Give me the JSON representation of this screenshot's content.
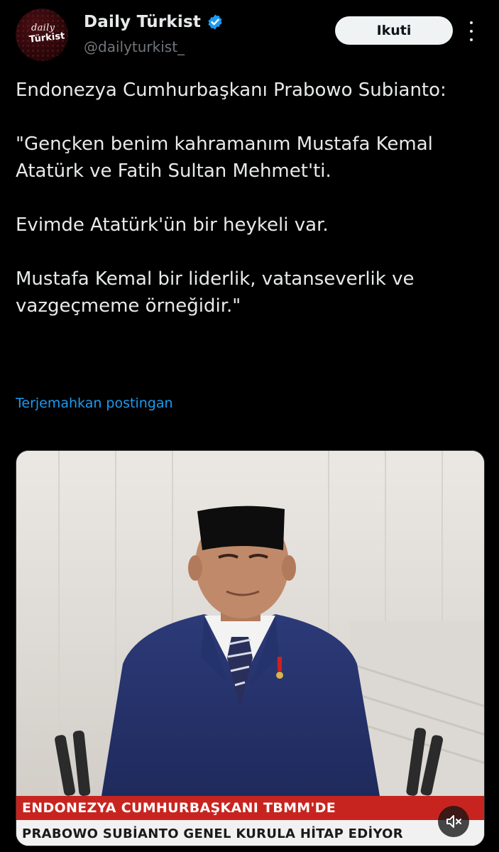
{
  "account": {
    "display_name": "Daily Türkist",
    "handle": "@dailyturkist_",
    "verified_icon": "verified-badge-icon",
    "avatar_text_line1": "daily",
    "avatar_text_line2": "Türkist"
  },
  "actions": {
    "follow_label": "Ikuti",
    "more_icon": "more-options-icon"
  },
  "tweet": {
    "lines": [
      "Endonezya Cumhurbaşkanı Prabowo Subianto:",
      "\"Gençken benim kahramanım Mustafa Kemal Atatürk ve Fatih Sultan Mehmet'ti.",
      "Evimde Atatürk'ün bir heykeli var.",
      "Mustafa Kemal bir liderlik, vatanseverlik ve vazgeçmeme örneğidir.\""
    ],
    "translate_label": "Terjemahkan postingan"
  },
  "media": {
    "ticker_top": "ENDONEZYA CUMHURBAŞKANI TBMM'DE",
    "ticker_bottom": "PRABOWO SUBİANTO GENEL KURULA HİTAP EDİYOR",
    "mute_icon": "muted-speaker-icon"
  },
  "colors": {
    "background": "#000000",
    "text": "#e7e9ea",
    "secondary_text": "#71767b",
    "link": "#1d9bf0",
    "verified": "#1d9bf0",
    "ticker_red": "#c8241f"
  }
}
